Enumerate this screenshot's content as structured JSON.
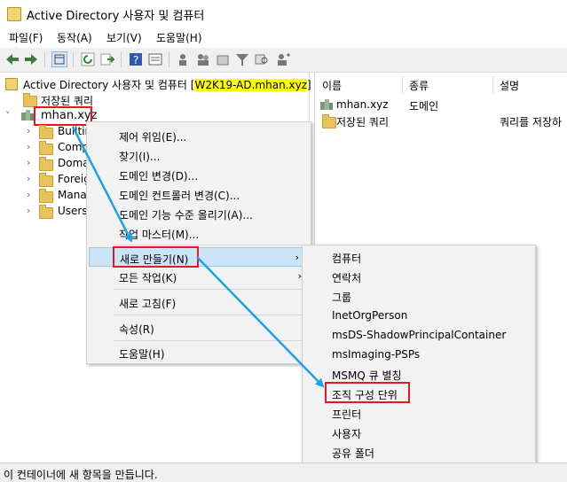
{
  "window": {
    "title": "Active Directory 사용자 및 컴퓨터"
  },
  "menu": [
    "파일(F)",
    "동작(A)",
    "보기(V)",
    "도움말(H)"
  ],
  "tree": {
    "root_label": "Active Directory 사용자 및 컴퓨터 [",
    "root_server": "W2K19-AD.mhan.xyz",
    "root_close": "]",
    "saved_queries": "저장된 쿼리",
    "domain": "mhan.xyz",
    "children": [
      "Builtin",
      "Comp",
      "Doma",
      "Foreig",
      "Manag",
      "Users"
    ]
  },
  "list": {
    "columns": [
      "이름",
      "종류",
      "설명"
    ],
    "rows": [
      {
        "name": "mhan.xyz",
        "type": "도메인",
        "desc": ""
      },
      {
        "name": "저장된 쿼리",
        "type": "",
        "desc": "쿼리를 저장하"
      }
    ]
  },
  "context_menu": {
    "items": [
      "제어 위임(E)...",
      "찾기(I)...",
      "도메인 변경(D)...",
      "도메인 컨트롤러 변경(C)...",
      "도메인 기능 수준 올리기(A)...",
      "작업 마스터(M)..."
    ],
    "new": "새로 만들기(N)",
    "all_tasks": "모든 작업(K)",
    "refresh": "새로 고침(F)",
    "properties": "속성(R)",
    "help": "도움말(H)"
  },
  "submenu": {
    "items": [
      "컴퓨터",
      "연락처",
      "그룹",
      "InetOrgPerson",
      "msDS-ShadowPrincipalContainer",
      "msImaging-PSPs",
      "MSMQ 큐 별칭"
    ],
    "ou": "조직 구성 단위",
    "rest": [
      "프린터",
      "사용자",
      "공유 폴더"
    ]
  },
  "status": "이 컨테이너에 새 항목을 만듭니다.",
  "colors": {
    "highlight_box": "#e8171f",
    "arrow": "#1aa3e8",
    "menu_highlight": "#cce4f7",
    "server_highlight": "#ffff00"
  }
}
